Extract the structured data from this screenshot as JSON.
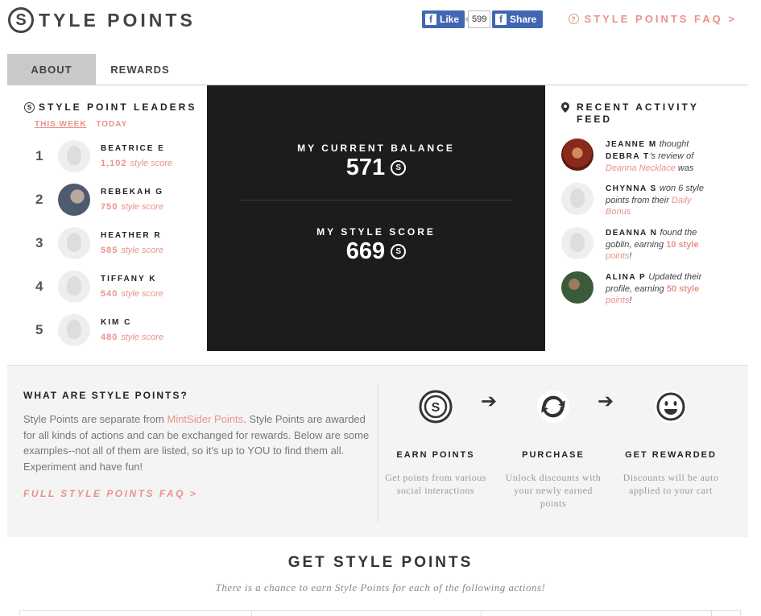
{
  "header": {
    "logo_mark": "S",
    "logo_text": "TYLE POINTS",
    "fb_like_label": "Like",
    "fb_like_count": "599",
    "fb_share_label": "Share",
    "faq_link": "STYLE POINTS FAQ >"
  },
  "tabs": [
    {
      "label": "ABOUT",
      "active": true
    },
    {
      "label": "REWARDS",
      "active": false
    }
  ],
  "leaders": {
    "title": "STYLE POINT LEADERS",
    "periods": [
      "THIS WEEK",
      "TODAY"
    ],
    "score_suffix": "style score",
    "entries": [
      {
        "rank": "1",
        "name": "BEATRICE E",
        "score": "1,102"
      },
      {
        "rank": "2",
        "name": "REBEKAH G",
        "score": "750"
      },
      {
        "rank": "3",
        "name": "HEATHER R",
        "score": "585"
      },
      {
        "rank": "4",
        "name": "TIFFANY K",
        "score": "540"
      },
      {
        "rank": "5",
        "name": "KIM C",
        "score": "480"
      }
    ]
  },
  "balance": {
    "current_label": "MY CURRENT BALANCE",
    "current_value": "571",
    "score_label": "MY STYLE SCORE",
    "score_value": "669",
    "coin_glyph": "S"
  },
  "activity": {
    "title": "RECENT ACTIVITY FEED",
    "items": [
      {
        "name": "JEANNE M",
        "t1": " thought ",
        "name2": "DEBRA T",
        "t2": "'s review of ",
        "link": "Deanna Necklace",
        "t3": " was"
      },
      {
        "name": "CHYNNA S",
        "t1": " won 6 style points from their ",
        "link": "Daily Bonus",
        "t3": ""
      },
      {
        "name": "DEANNA N",
        "t1": " found the goblin, earning ",
        "points": "10 style",
        "link": "points",
        "t3": "!"
      },
      {
        "name": "ALINA P",
        "t1": " Updated their profile, earning ",
        "points": "50 style",
        "link": "points",
        "t3": "!"
      }
    ]
  },
  "what": {
    "title": "WHAT ARE STYLE POINTS?",
    "body_1": "Style Points are separate from ",
    "body_link": "MintSider Points",
    "body_2": ". Style Points are awarded for all kinds of actions and can be exchanged for rewards. Below are some examples--not all of them are listed, so it's up to YOU to find them all. Experiment and have fun!",
    "faq_link": "FULL STYLE POINTS FAQ >",
    "steps": [
      {
        "icon": "coin-icon",
        "title": "EARN POINTS",
        "desc": "Get points from various social interactions"
      },
      {
        "icon": "refresh-icon",
        "title": "PURCHASE",
        "desc": "Unlock discounts with your newly earned points"
      },
      {
        "icon": "smiley-icon",
        "title": "GET REWARDED",
        "desc": "Discounts will be auto applied to your cart"
      }
    ],
    "arrow": "➔"
  },
  "get": {
    "title": "GET STYLE POINTS",
    "subtitle": "There is a chance to earn Style Points for each of the following actions!"
  },
  "colors": {
    "accent": "#e8938a",
    "panel": "#1c1c1c",
    "fb": "#4267b2"
  }
}
